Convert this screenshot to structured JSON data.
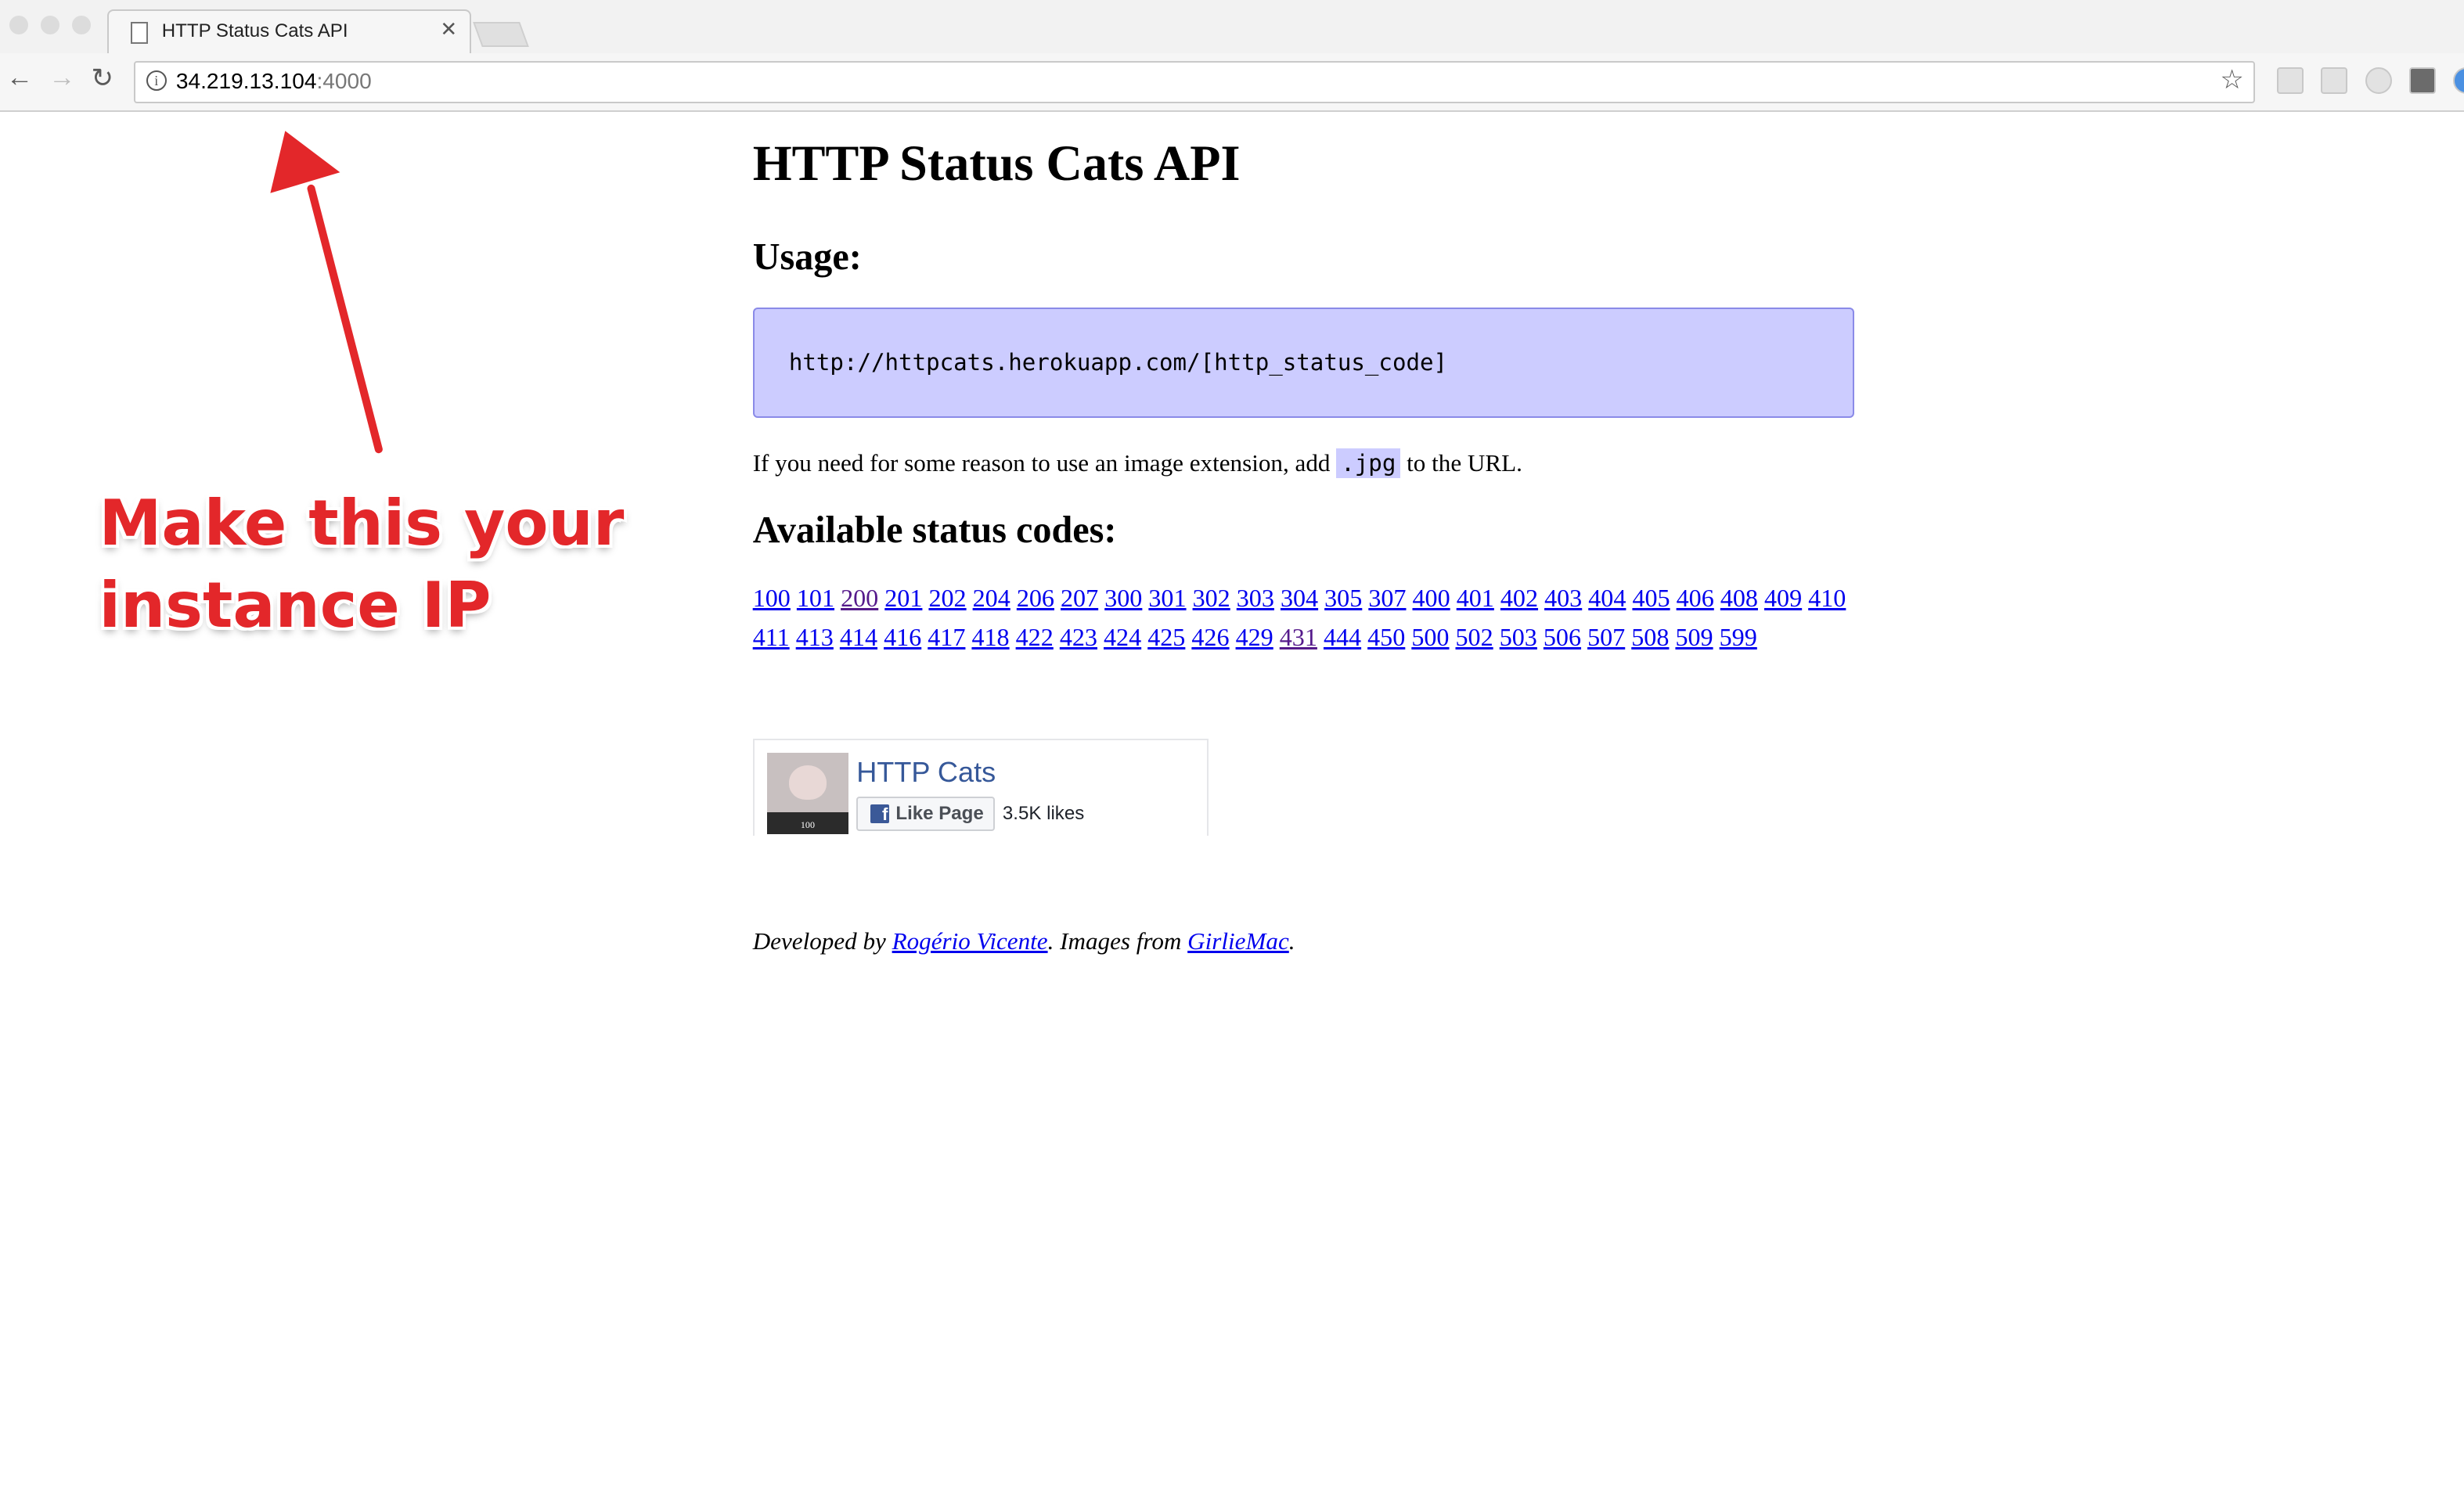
{
  "browser": {
    "tab_title": "HTTP Status Cats API",
    "url_host": "34.219.13.104",
    "url_port": ":4000"
  },
  "page": {
    "title": "HTTP Status Cats API",
    "usage_heading": "Usage:",
    "usage_code": "http://httpcats.herokuapp.com/[http_status_code]",
    "extension_text_before": "If you need for some reason to use an image extension, add ",
    "extension_code": ".jpg",
    "extension_text_after": " to the URL.",
    "codes_heading": "Available status codes:",
    "codes_row1": [
      "100",
      "101",
      "200",
      "201",
      "202",
      "204",
      "206",
      "207",
      "300",
      "301",
      "302",
      "303",
      "304",
      "305",
      "307",
      "400",
      "401",
      "402",
      "403",
      "404",
      "405",
      "406",
      "408",
      "409",
      "410"
    ],
    "codes_row2": [
      "411",
      "413",
      "414",
      "416",
      "417",
      "418",
      "422",
      "423",
      "424",
      "425",
      "426",
      "429",
      "431",
      "444",
      "450",
      "500",
      "502",
      "503",
      "506",
      "507",
      "508",
      "509",
      "599"
    ],
    "visited_codes": [
      "200",
      "431"
    ]
  },
  "facebook": {
    "page_name": "HTTP Cats",
    "like_label": "Like Page",
    "likes": "3.5K likes",
    "thumb_number": "100"
  },
  "footer": {
    "prefix": "Developed by ",
    "author": "Rogério Vicente",
    "middle": ". Images from ",
    "source": "GirlieMac",
    "suffix": "."
  },
  "annotation": {
    "line1": "Make this your",
    "line2": "instance IP",
    "color": "#e3272a"
  }
}
